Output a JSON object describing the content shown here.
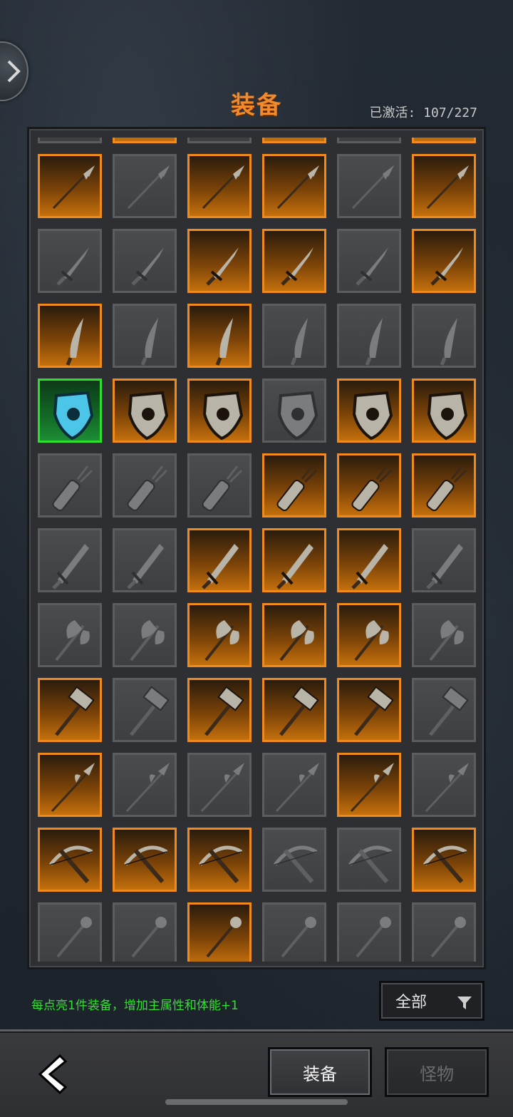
{
  "header": {
    "title": "装备",
    "count_label": "已激活: 107/227"
  },
  "colors": {
    "title": "#f08a2c",
    "active_slot": "#f08a1c",
    "rare_slot": "#2ee02e",
    "hint": "#33e033"
  },
  "grid": {
    "columns": 6,
    "rows": [
      {
        "category": "maces",
        "slots": [
          "inactive",
          "active",
          "inactive",
          "active",
          "inactive",
          "active"
        ]
      },
      {
        "category": "spears",
        "slots": [
          "active",
          "inactive",
          "active",
          "active",
          "inactive",
          "active"
        ]
      },
      {
        "category": "daggers",
        "slots": [
          "inactive",
          "inactive",
          "active",
          "active",
          "inactive",
          "active"
        ]
      },
      {
        "category": "knives",
        "slots": [
          "active",
          "inactive",
          "active",
          "inactive",
          "inactive",
          "inactive"
        ]
      },
      {
        "category": "shields",
        "slots": [
          "rare",
          "active",
          "active",
          "inactive",
          "active",
          "active"
        ]
      },
      {
        "category": "quivers",
        "slots": [
          "inactive",
          "inactive",
          "inactive",
          "active",
          "active",
          "active"
        ]
      },
      {
        "category": "swords",
        "slots": [
          "inactive",
          "inactive",
          "active",
          "active",
          "active",
          "inactive"
        ]
      },
      {
        "category": "axes",
        "slots": [
          "inactive",
          "inactive",
          "active",
          "active",
          "active",
          "inactive"
        ]
      },
      {
        "category": "hammers",
        "slots": [
          "active",
          "inactive",
          "active",
          "active",
          "active",
          "inactive"
        ]
      },
      {
        "category": "polearms",
        "slots": [
          "active",
          "inactive",
          "inactive",
          "inactive",
          "active",
          "inactive"
        ]
      },
      {
        "category": "crossbows",
        "slots": [
          "active",
          "active",
          "active",
          "inactive",
          "inactive",
          "active"
        ]
      },
      {
        "category": "misc",
        "slots": [
          "inactive",
          "inactive",
          "active",
          "inactive",
          "inactive",
          "inactive"
        ]
      }
    ]
  },
  "footer": {
    "hint": "每点亮1件装备，增加主属性和体能+1",
    "filter_label": "全部",
    "filter_icon": "funnel-icon",
    "back_icon": "back-arrow-icon",
    "tabs": [
      {
        "label": "装备",
        "selected": true
      },
      {
        "label": "怪物",
        "selected": false
      }
    ]
  }
}
